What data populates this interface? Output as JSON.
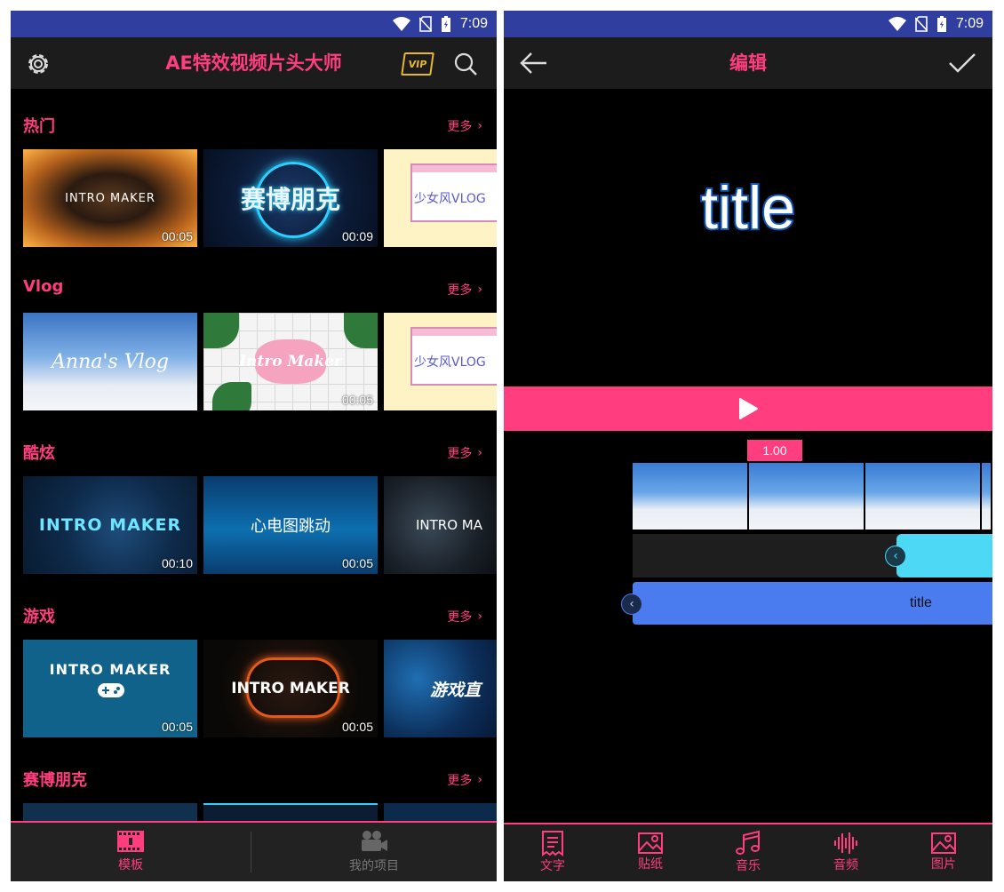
{
  "status": {
    "time": "7:09"
  },
  "left": {
    "app_title": "AE特效视频片头大师",
    "vip_label": "VIP",
    "more_label": "更多",
    "sections": [
      {
        "title": "热门",
        "thumbs": [
          {
            "text": "INTRO MAKER",
            "duration": "00:05"
          },
          {
            "text": "赛博朋克",
            "duration": "00:09"
          },
          {
            "text": "少女风VLOG",
            "duration": ""
          }
        ]
      },
      {
        "title": "Vlog",
        "thumbs": [
          {
            "text": "Anna's Vlog",
            "duration": ""
          },
          {
            "text": "Intro Maker",
            "duration": "00:05"
          },
          {
            "text": "少女风VLOG",
            "duration": ""
          }
        ]
      },
      {
        "title": "酷炫",
        "thumbs": [
          {
            "text": "INTRO MAKER",
            "duration": "00:10"
          },
          {
            "text": "心电图跳动",
            "duration": "00:05"
          },
          {
            "text": "INTRO MA",
            "duration": ""
          }
        ]
      },
      {
        "title": "游戏",
        "thumbs": [
          {
            "text": "INTRO MAKER",
            "duration": "00:05"
          },
          {
            "text": "INTRO MAKER",
            "duration": "00:05"
          },
          {
            "text": "游戏直",
            "duration": ""
          }
        ]
      },
      {
        "title": "赛博朋克",
        "thumbs": []
      }
    ],
    "nav": {
      "templates": "模板",
      "projects": "我的项目"
    }
  },
  "right": {
    "title": "编辑",
    "preview_text": "title",
    "speed_value": "1.00",
    "text_track_label": "title",
    "tools": [
      "文字",
      "贴纸",
      "音乐",
      "音频",
      "图片"
    ]
  },
  "colors": {
    "accent": "#ff3d7f",
    "statusbar": "#303f9f",
    "cyan_track": "#4dd8f5",
    "blue_track": "#4a7cf0"
  },
  "icons": [
    "settings-icon",
    "vip-icon",
    "search-icon",
    "chevron-right-icon",
    "film-icon",
    "video-camera-icon",
    "back-arrow-icon",
    "check-icon",
    "play-icon",
    "chevron-left-icon",
    "text-icon",
    "sticker-icon",
    "music-icon",
    "audio-icon",
    "image-icon"
  ]
}
